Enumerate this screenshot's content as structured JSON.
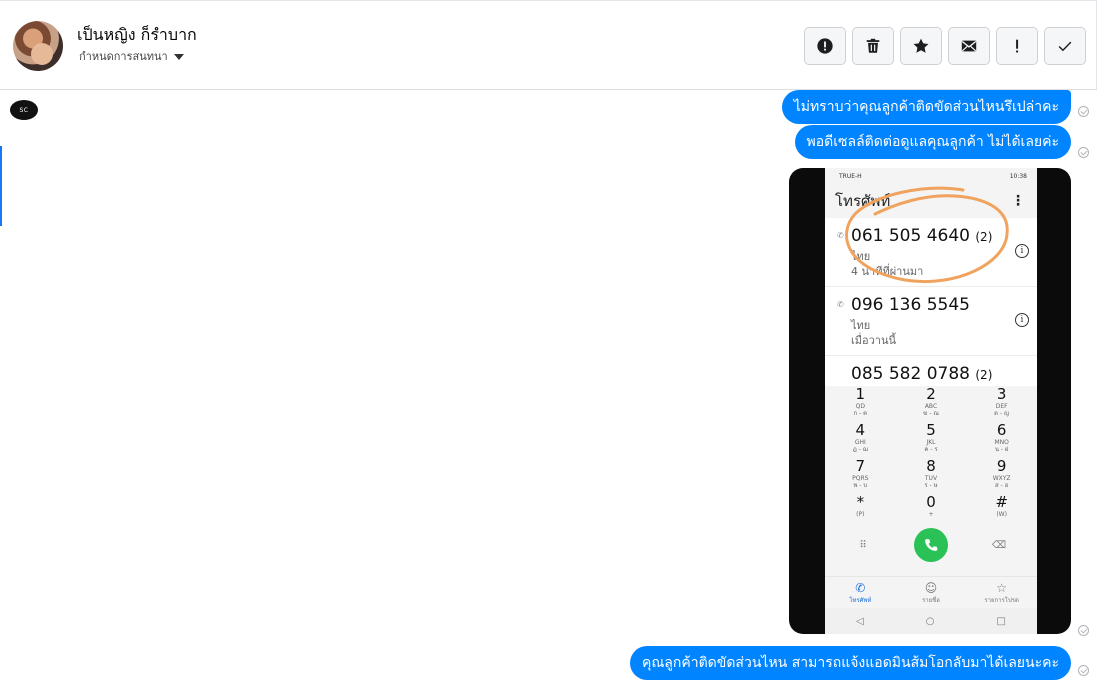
{
  "header": {
    "contact_name": "เป็นหญิง ก็รำบาก",
    "status_label": "กำหนดการสนทนา"
  },
  "toolbar": [
    {
      "icon": "alert-circle-icon",
      "glyph": "!"
    },
    {
      "icon": "trash-icon"
    },
    {
      "icon": "star-icon"
    },
    {
      "icon": "mail-icon"
    },
    {
      "icon": "exclamation-icon",
      "glyph": "!"
    },
    {
      "icon": "check-icon"
    }
  ],
  "messages": [
    {
      "text": "ไม่ทราบว่าคุณลูกค้าติดขัดส่วนไหนรึเปล่าคะ"
    },
    {
      "text": "พอดีเซลล์ติดต่อดูแลคุณลูกค้า ไม่ได้เลยค่ะ"
    },
    {
      "text": "คุณลูกค้าติดขัดส่วนไหน สามารถแจ้งแอดมินส้มโอกลับมาได้เลยนะคะ"
    }
  ],
  "phone": {
    "status_left": "TRUE-H",
    "status_right": "10:38",
    "title": "โทรศัพท์",
    "calls": [
      {
        "number": "061 505 4640",
        "count": "(2)",
        "location": "ไทย",
        "time": "4 นาทีที่ผ่านมา"
      },
      {
        "number": "096 136 5545",
        "count": "",
        "location": "ไทย",
        "time": "เมื่อวานนี้"
      },
      {
        "number": "085 582 0788",
        "count": "(2)",
        "location": "",
        "time": ""
      }
    ],
    "keys": [
      [
        {
          "d": "1",
          "l": "QD\nก - ฅ"
        },
        {
          "d": "2",
          "l": "ABC\nฆ - ณ"
        },
        {
          "d": "3",
          "l": "DEF\nด - ญ"
        }
      ],
      [
        {
          "d": "4",
          "l": "GHI\nฎ - ฌ"
        },
        {
          "d": "5",
          "l": "JKL\nค - ร"
        },
        {
          "d": "6",
          "l": "MNO\nน - ฝ"
        }
      ],
      [
        {
          "d": "7",
          "l": "PQRS\nพ - บ"
        },
        {
          "d": "8",
          "l": "TUV\nร - ษ"
        },
        {
          "d": "9",
          "l": "WXYZ\nส - ฮ"
        }
      ],
      [
        {
          "d": "*",
          "l": "(P)"
        },
        {
          "d": "0",
          "l": "+"
        },
        {
          "d": "#",
          "l": "(W)"
        }
      ]
    ],
    "tabs": [
      "โทรศัพท์",
      "รายชื่อ",
      "รายการโปรด"
    ]
  },
  "colors": {
    "bubble": "#0084ff",
    "annotation": "#f0a35e",
    "call_button": "#2ac256"
  }
}
